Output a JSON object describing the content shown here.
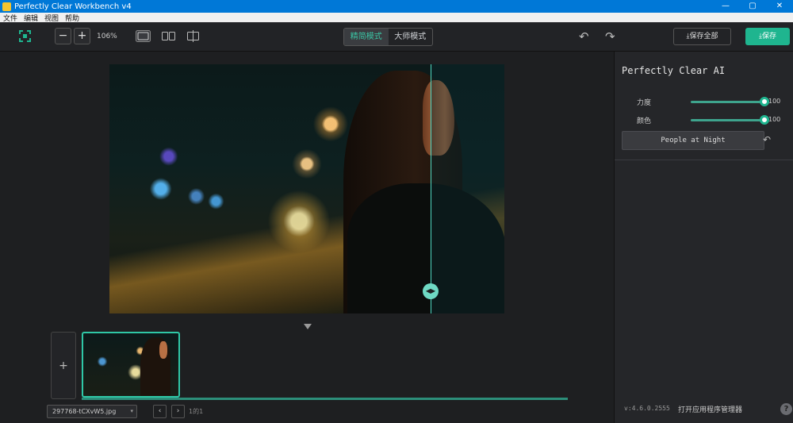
{
  "window": {
    "title": "Perfectly Clear Workbench v4",
    "minimize": "—",
    "maximize": "▢",
    "close": "✕"
  },
  "menu": [
    "文件",
    "编辑",
    "视图",
    "帮助"
  ],
  "toolbar": {
    "zoom_out": "−",
    "zoom_in": "+",
    "zoom_level": "106%",
    "modes": [
      "精简模式",
      "大师模式"
    ],
    "active_mode": "精简模式",
    "undo": "↶",
    "redo": "↷",
    "save_all": "⤓保存全部",
    "save": "⤓保存",
    "accent": "#1fb58f"
  },
  "filmstrip": {
    "add": "+",
    "file_name": "297768-tCXvW5.jpg",
    "prev": "‹",
    "next": "›",
    "page": "1的1"
  },
  "panel": {
    "title": "Perfectly Clear AI",
    "sliders": [
      {
        "label": "力度",
        "value": "100",
        "level": 1.0
      },
      {
        "label": "颜色",
        "value": "100",
        "level": 1.0
      }
    ],
    "preset": "People at Night",
    "preset_reset": "↶",
    "version": "v:4.6.0.2555",
    "manager": "打开应用程序管理器",
    "help": "?"
  }
}
